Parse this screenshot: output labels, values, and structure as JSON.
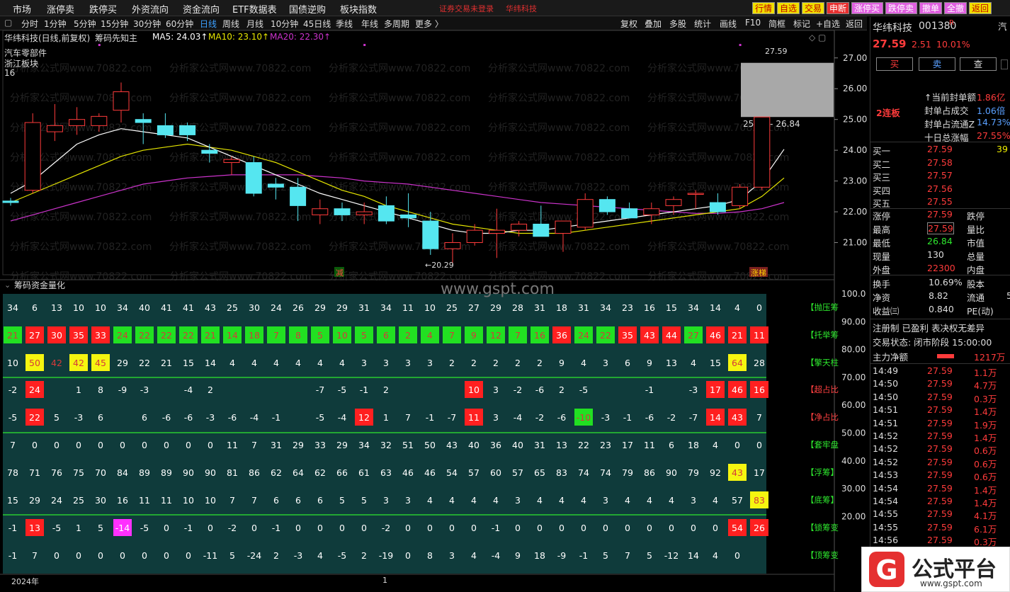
{
  "menu": {
    "items": [
      "市场",
      "涨停卖",
      "跌停买",
      "外资流向",
      "资金流向",
      "ETF数据表",
      "国债逆购",
      "板块指数"
    ],
    "warning": "证券交易未登录",
    "stock_link": "华纬科技",
    "right_buttons": [
      {
        "label": "行情",
        "bg": "#f0e000",
        "fg": "#c00000"
      },
      {
        "label": "自选",
        "bg": "#f0e000",
        "fg": "#c00000"
      },
      {
        "label": "交易",
        "bg": "#f0e000",
        "fg": "#c00000"
      },
      {
        "label": "申断",
        "bg": "#e83030",
        "fg": "#ffffff"
      },
      {
        "label": "涨停买",
        "bg": "#e060e0",
        "fg": "#ffffff"
      },
      {
        "label": "跌停卖",
        "bg": "#e060e0",
        "fg": "#ffffff"
      },
      {
        "label": "撤单",
        "bg": "#e060e0",
        "fg": "#ffffff"
      },
      {
        "label": "全撤",
        "bg": "#e060e0",
        "fg": "#ffffff"
      },
      {
        "label": "返回",
        "bg": "#f0e000",
        "fg": "#c00000"
      }
    ]
  },
  "toolbar": {
    "periods": [
      "分时",
      "1分钟",
      "5分钟",
      "15分钟",
      "30分钟",
      "60分钟",
      "日线",
      "周线",
      "月线",
      "10分钟",
      "45日线",
      "季线",
      "年线",
      "多周期",
      "更多 〉"
    ],
    "active": "日线",
    "tools": [
      "复权",
      "叠加",
      "多股",
      "统计",
      "画线",
      "F10",
      "简框",
      "标记",
      "+自选",
      "返回"
    ]
  },
  "main": {
    "title": "华纬科技(日线,前复权)",
    "indicator": "筹码先知主",
    "ma5": "MA5: 24.03↑",
    "ma10": "MA10: 23.10↑",
    "ma20": "MA20: 22.30↑",
    "sector1": "汽车零部件",
    "sector2": "浙江板块",
    "count": "16",
    "high_label": "27.59",
    "low_label": "←20.29",
    "band_label": "25.08 - 26.84",
    "tag_jian": "减",
    "tag_zt": "涨梯",
    "y_ticks": [
      "27.00",
      "26.00",
      "25.00",
      "24.00",
      "23.00",
      "22.00",
      "21.00"
    ],
    "watermark": "分析家公式网www.70822.com",
    "gspt": "www.gspt.com"
  },
  "chart_data": {
    "type": "candlestick",
    "ylim": [
      20.0,
      27.8
    ],
    "ohlc": [
      [
        22.35,
        22.45,
        22.2,
        22.3
      ],
      [
        22.7,
        25.2,
        22.6,
        24.9
      ],
      [
        24.6,
        25.5,
        24.3,
        24.8
      ],
      [
        24.8,
        25.4,
        24.5,
        25.0
      ],
      [
        24.8,
        25.2,
        24.6,
        25.1
      ],
      [
        25.3,
        26.2,
        24.9,
        25.9
      ],
      [
        25.0,
        25.2,
        24.2,
        24.9
      ],
      [
        24.8,
        25.2,
        24.4,
        24.5
      ],
      [
        24.8,
        24.9,
        24.3,
        24.5
      ],
      [
        24.0,
        24.2,
        23.6,
        23.9
      ],
      [
        23.6,
        23.8,
        23.2,
        23.7
      ],
      [
        23.6,
        23.8,
        22.5,
        22.6
      ],
      [
        22.9,
        23.1,
        22.4,
        22.8
      ],
      [
        22.8,
        23.1,
        21.7,
        22.2
      ],
      [
        21.9,
        22.4,
        21.6,
        22.1
      ],
      [
        22.1,
        22.3,
        21.7,
        21.9
      ],
      [
        21.9,
        22.3,
        21.6,
        22.0
      ],
      [
        22.2,
        22.5,
        21.6,
        21.7
      ],
      [
        21.9,
        22.6,
        21.5,
        21.8
      ],
      [
        21.7,
        22.0,
        20.6,
        20.8
      ],
      [
        20.8,
        21.3,
        20.29,
        21.0
      ],
      [
        21.0,
        21.6,
        20.9,
        21.4
      ],
      [
        21.3,
        22.1,
        20.5,
        21.4
      ],
      [
        21.4,
        21.7,
        21.2,
        21.6
      ],
      [
        21.6,
        22.2,
        21.2,
        21.2
      ],
      [
        21.3,
        21.7,
        20.7,
        21.7
      ],
      [
        21.5,
        22.6,
        21.4,
        22.4
      ],
      [
        22.4,
        22.5,
        21.9,
        22.0
      ],
      [
        22.1,
        22.3,
        21.8,
        21.8
      ],
      [
        21.9,
        22.3,
        21.6,
        22.1
      ],
      [
        22.2,
        22.5,
        21.9,
        22.4
      ],
      [
        22.6,
        22.7,
        22.1,
        22.6
      ],
      [
        22.3,
        22.6,
        21.9,
        22.0
      ],
      [
        22.2,
        22.9,
        22.1,
        22.8
      ],
      [
        22.8,
        25.08,
        22.7,
        25.08
      ],
      [
        25.08,
        27.59,
        25.08,
        27.59
      ],
      [
        27.59,
        27.59,
        27.59,
        27.59
      ]
    ],
    "ma5": [
      22.6,
      23.0,
      23.6,
      24.2,
      24.5,
      24.7,
      24.6,
      24.5,
      24.4,
      24.1,
      23.8,
      23.5,
      23.2,
      22.9,
      22.6,
      22.4,
      22.2,
      22.0,
      21.8,
      21.6,
      21.4,
      21.3,
      21.3,
      21.4,
      21.4,
      21.5,
      21.6,
      21.7,
      21.8,
      21.9,
      22.0,
      22.1,
      22.2,
      22.4,
      23.0,
      24.03
    ],
    "ma10": [
      22.3,
      22.6,
      22.9,
      23.2,
      23.5,
      23.8,
      24.0,
      24.1,
      24.2,
      24.1,
      24.0,
      23.8,
      23.6,
      23.3,
      23.0,
      22.7,
      22.5,
      22.2,
      22.0,
      21.8,
      21.6,
      21.5,
      21.4,
      21.3,
      21.3,
      21.3,
      21.4,
      21.5,
      21.6,
      21.7,
      21.8,
      21.9,
      22.0,
      22.1,
      22.5,
      23.1
    ],
    "ma20": [
      21.7,
      21.9,
      22.1,
      22.3,
      22.5,
      22.7,
      22.9,
      23.0,
      23.1,
      23.15,
      23.2,
      23.2,
      23.2,
      23.2,
      23.15,
      23.1,
      23.0,
      22.95,
      22.9,
      22.8,
      22.7,
      22.6,
      22.5,
      22.4,
      22.3,
      22.25,
      22.2,
      22.15,
      22.1,
      22.05,
      22.0,
      21.95,
      21.95,
      22.0,
      22.1,
      22.3
    ]
  },
  "sub": {
    "title": "筹码资金量化",
    "y_ticks": [
      "100.0",
      "90.00",
      "80.00",
      "70.00",
      "60.00",
      "50.00",
      "40.00",
      "30.00",
      "20.00"
    ],
    "year": "2024年",
    "marker": "1",
    "rows": [
      {
        "label": "【抛压筹",
        "vals": [
          "34",
          "6",
          "13",
          "10",
          "10",
          "34",
          "40",
          "41",
          "41",
          "43",
          "25",
          "30",
          "24",
          "26",
          "29",
          "29",
          "31",
          "34",
          "11",
          "10",
          "25",
          "27",
          "29",
          "28",
          "31",
          "18",
          "31",
          "34",
          "23",
          "16",
          "15",
          "34",
          "14",
          "4",
          "0"
        ],
        "hl": {}
      },
      {
        "label": "【托举筹",
        "vals": [
          "21",
          "27",
          "30",
          "35",
          "33",
          "24",
          "22",
          "22",
          "22",
          "21",
          "14",
          "18",
          "7",
          "8",
          "5",
          "10",
          "5",
          "6",
          "2",
          "4",
          "7",
          "9",
          "12",
          "7",
          "16",
          "36",
          "24",
          "22",
          "35",
          "43",
          "44",
          "27",
          "46",
          "21",
          "11"
        ],
        "hl": {
          "0": "g",
          "1": "r",
          "2": "r",
          "3": "r",
          "4": "r",
          "5": "g",
          "6": "g",
          "7": "g",
          "8": "g",
          "9": "g",
          "10": "g",
          "11": "g",
          "12": "g",
          "13": "g",
          "14": "g",
          "15": "g",
          "16": "g",
          "17": "g",
          "18": "g",
          "19": "g",
          "20": "g",
          "21": "g",
          "22": "g",
          "23": "g",
          "24": "g",
          "25": "r",
          "26": "g",
          "27": "g",
          "28": "r",
          "29": "r",
          "30": "r",
          "31": "g",
          "32": "r",
          "33": "r",
          "34": "r"
        }
      },
      {
        "label": "【擎天柱",
        "vals": [
          "10",
          "50",
          "42",
          "42",
          "45",
          "29",
          "22",
          "21",
          "15",
          "14",
          "4",
          "4",
          "4",
          "4",
          "4",
          "4",
          "3",
          "3",
          "3",
          "3",
          "2",
          "2",
          "2",
          "2",
          "2",
          "9",
          "4",
          "3",
          "6",
          "9",
          "13",
          "4",
          "15",
          "64",
          "28"
        ],
        "hl": {
          "1": "y",
          "3": "y",
          "4": "y",
          "33": "y"
        }
      },
      {
        "label": "【超占比",
        "vals": [
          "-2",
          "24",
          "",
          "1",
          "8",
          "-9",
          "-3",
          "",
          "-4",
          "2",
          "",
          "",
          "",
          "",
          "-7",
          "-5",
          "-1",
          "2",
          "",
          "",
          "",
          "10",
          "3",
          "-2",
          "-6",
          "2",
          "-5",
          "",
          "",
          "-1",
          "",
          "-3",
          "17",
          "46",
          "16"
        ],
        "hl": {
          "1": "r",
          "21": "r",
          "32": "r",
          "33": "r",
          "34": "r"
        }
      },
      {
        "label": "【净占比",
        "vals": [
          "-5",
          "22",
          "5",
          "-3",
          "6",
          "",
          "6",
          "-6",
          "-6",
          "-3",
          "-6",
          "-4",
          "-1",
          "",
          "-5",
          "-4",
          "12",
          "1",
          "7",
          "-1",
          "-7",
          "11",
          "3",
          "-4",
          "-2",
          "-6",
          "-10",
          "-3",
          "-1",
          "-6",
          "-2",
          "-7",
          "14",
          "43",
          "7"
        ],
        "hl": {
          "1": "r",
          "16": "r",
          "21": "r",
          "26": "g",
          "32": "r",
          "33": "r"
        }
      },
      {
        "label": "【套牢盘",
        "vals": [
          "7",
          "0",
          "0",
          "0",
          "0",
          "0",
          "0",
          "0",
          "0",
          "0",
          "11",
          "7",
          "31",
          "29",
          "33",
          "29",
          "34",
          "32",
          "51",
          "50",
          "43",
          "40",
          "36",
          "40",
          "31",
          "13",
          "22",
          "23",
          "17",
          "11",
          "6",
          "18",
          "4",
          "0",
          "0"
        ],
        "hl": {}
      },
      {
        "label": "【浮筹】",
        "vals": [
          "78",
          "71",
          "76",
          "75",
          "70",
          "84",
          "89",
          "89",
          "90",
          "90",
          "81",
          "86",
          "62",
          "64",
          "62",
          "66",
          "61",
          "63",
          "46",
          "46",
          "54",
          "57",
          "60",
          "57",
          "65",
          "83",
          "74",
          "74",
          "79",
          "86",
          "90",
          "79",
          "92",
          "43",
          "17"
        ],
        "hl": {
          "33": "y"
        }
      },
      {
        "label": "【底筹】",
        "vals": [
          "15",
          "29",
          "24",
          "25",
          "30",
          "16",
          "11",
          "11",
          "10",
          "10",
          "7",
          "7",
          "6",
          "6",
          "6",
          "5",
          "5",
          "3",
          "3",
          "4",
          "4",
          "4",
          "4",
          "3",
          "4",
          "4",
          "4",
          "3",
          "4",
          "4",
          "4",
          "3",
          "4",
          "57",
          "83"
        ],
        "hl": {
          "34": "y"
        }
      },
      {
        "label": "【锁筹变",
        "vals": [
          "-1",
          "13",
          "-5",
          "1",
          "5",
          "-14",
          "-5",
          "0",
          "-1",
          "0",
          "-2",
          "0",
          "-1",
          "0",
          "0",
          "0",
          "0",
          "-2",
          "0",
          "0",
          "0",
          "0",
          "-1",
          "0",
          "0",
          "0",
          "0",
          "0",
          "0",
          "0",
          "0",
          "0",
          "0",
          "54",
          "26"
        ],
        "hl": {
          "1": "r",
          "5": "m",
          "33": "r",
          "34": "r"
        }
      },
      {
        "label": "【顶筹变",
        "vals": [
          "-1",
          "7",
          "0",
          "0",
          "0",
          "0",
          "0",
          "0",
          "0",
          "-11",
          "5",
          "-24",
          "2",
          "-3",
          "4",
          "-5",
          "2",
          "-19",
          "0",
          "8",
          "3",
          "4",
          "-4",
          "9",
          "18",
          "-9",
          "-1",
          "5",
          "7",
          "5",
          "-12",
          "14",
          "4",
          "0",
          ""
        ],
        "hl": {}
      }
    ]
  },
  "right": {
    "name": "华纬科技",
    "code": "001380",
    "r_mark": "R",
    "price": "27.59",
    "change": "2.51",
    "pct": "10.01%",
    "edge_char": "汽",
    "btn_buy": "买",
    "btn_sell": "卖",
    "btn_query": "查",
    "lianban": "2连板",
    "fd_amount_label": "↑当前封单额",
    "fd_amount": "1.86亿",
    "fd_cj_label": "封单占成交",
    "fd_cj": "1.06倍",
    "fd_lt_label": "封单占流通Z",
    "fd_lt": "14.73%",
    "ten_label": "十日总涨幅",
    "ten": "27.55%",
    "book": [
      [
        "买一",
        "27.59",
        "39"
      ],
      [
        "买二",
        "27.58",
        ""
      ],
      [
        "买三",
        "27.57",
        ""
      ],
      [
        "买四",
        "27.56",
        ""
      ],
      [
        "买五",
        "27.55",
        ""
      ]
    ],
    "stats": [
      [
        "涨停",
        "27.59",
        "跌停",
        ""
      ],
      [
        "最高",
        "27.59",
        "量比",
        ""
      ],
      [
        "最低",
        "26.84",
        "市值",
        ""
      ],
      [
        "现量",
        "130",
        "总量",
        ""
      ],
      [
        "外盘",
        "22300",
        "内盘",
        ""
      ]
    ],
    "hs": [
      "换手",
      "10.69%",
      "股本",
      ""
    ],
    "jz": [
      "净资",
      "8.82",
      "流通",
      "5"
    ],
    "sy": [
      "收益㈢",
      "0.840",
      "PE(动)",
      ""
    ],
    "reg": "注册制 已盈利 表决权无差异",
    "status": "交易状态: 闭市阶段 15:00:00",
    "net_label": "主力净额",
    "net_value": "1217万",
    "ticks": [
      [
        "14:49",
        "27.59",
        "1.1万"
      ],
      [
        "14:50",
        "27.59",
        "4.7万"
      ],
      [
        "14:50",
        "27.59",
        "0.3万"
      ],
      [
        "14:51",
        "27.59",
        "1.4万"
      ],
      [
        "14:51",
        "27.59",
        "1.9万"
      ],
      [
        "14:52",
        "27.59",
        "1.4万"
      ],
      [
        "14:52",
        "27.59",
        "0.6万"
      ],
      [
        "14:52",
        "27.59",
        "0.6万"
      ],
      [
        "14:53",
        "27.59",
        "0.6万"
      ],
      [
        "14:54",
        "27.59",
        "1.4万"
      ],
      [
        "14:54",
        "27.59",
        "1.4万"
      ],
      [
        "14:55",
        "27.59",
        "4.1万"
      ],
      [
        "14:55",
        "27.59",
        "6.1万"
      ],
      [
        "14:56",
        "27.59",
        "0.3万"
      ]
    ]
  },
  "logo": {
    "text": "公式平台",
    "url": "www.gspt.com",
    "mark": "G"
  },
  "colors": {
    "up": "#ff3b3b",
    "down": "#55e6f0",
    "ma5": "#ffffff",
    "ma10": "#e6e600",
    "ma20": "#cc33cc",
    "sub_bg": "#0f3b3b"
  }
}
